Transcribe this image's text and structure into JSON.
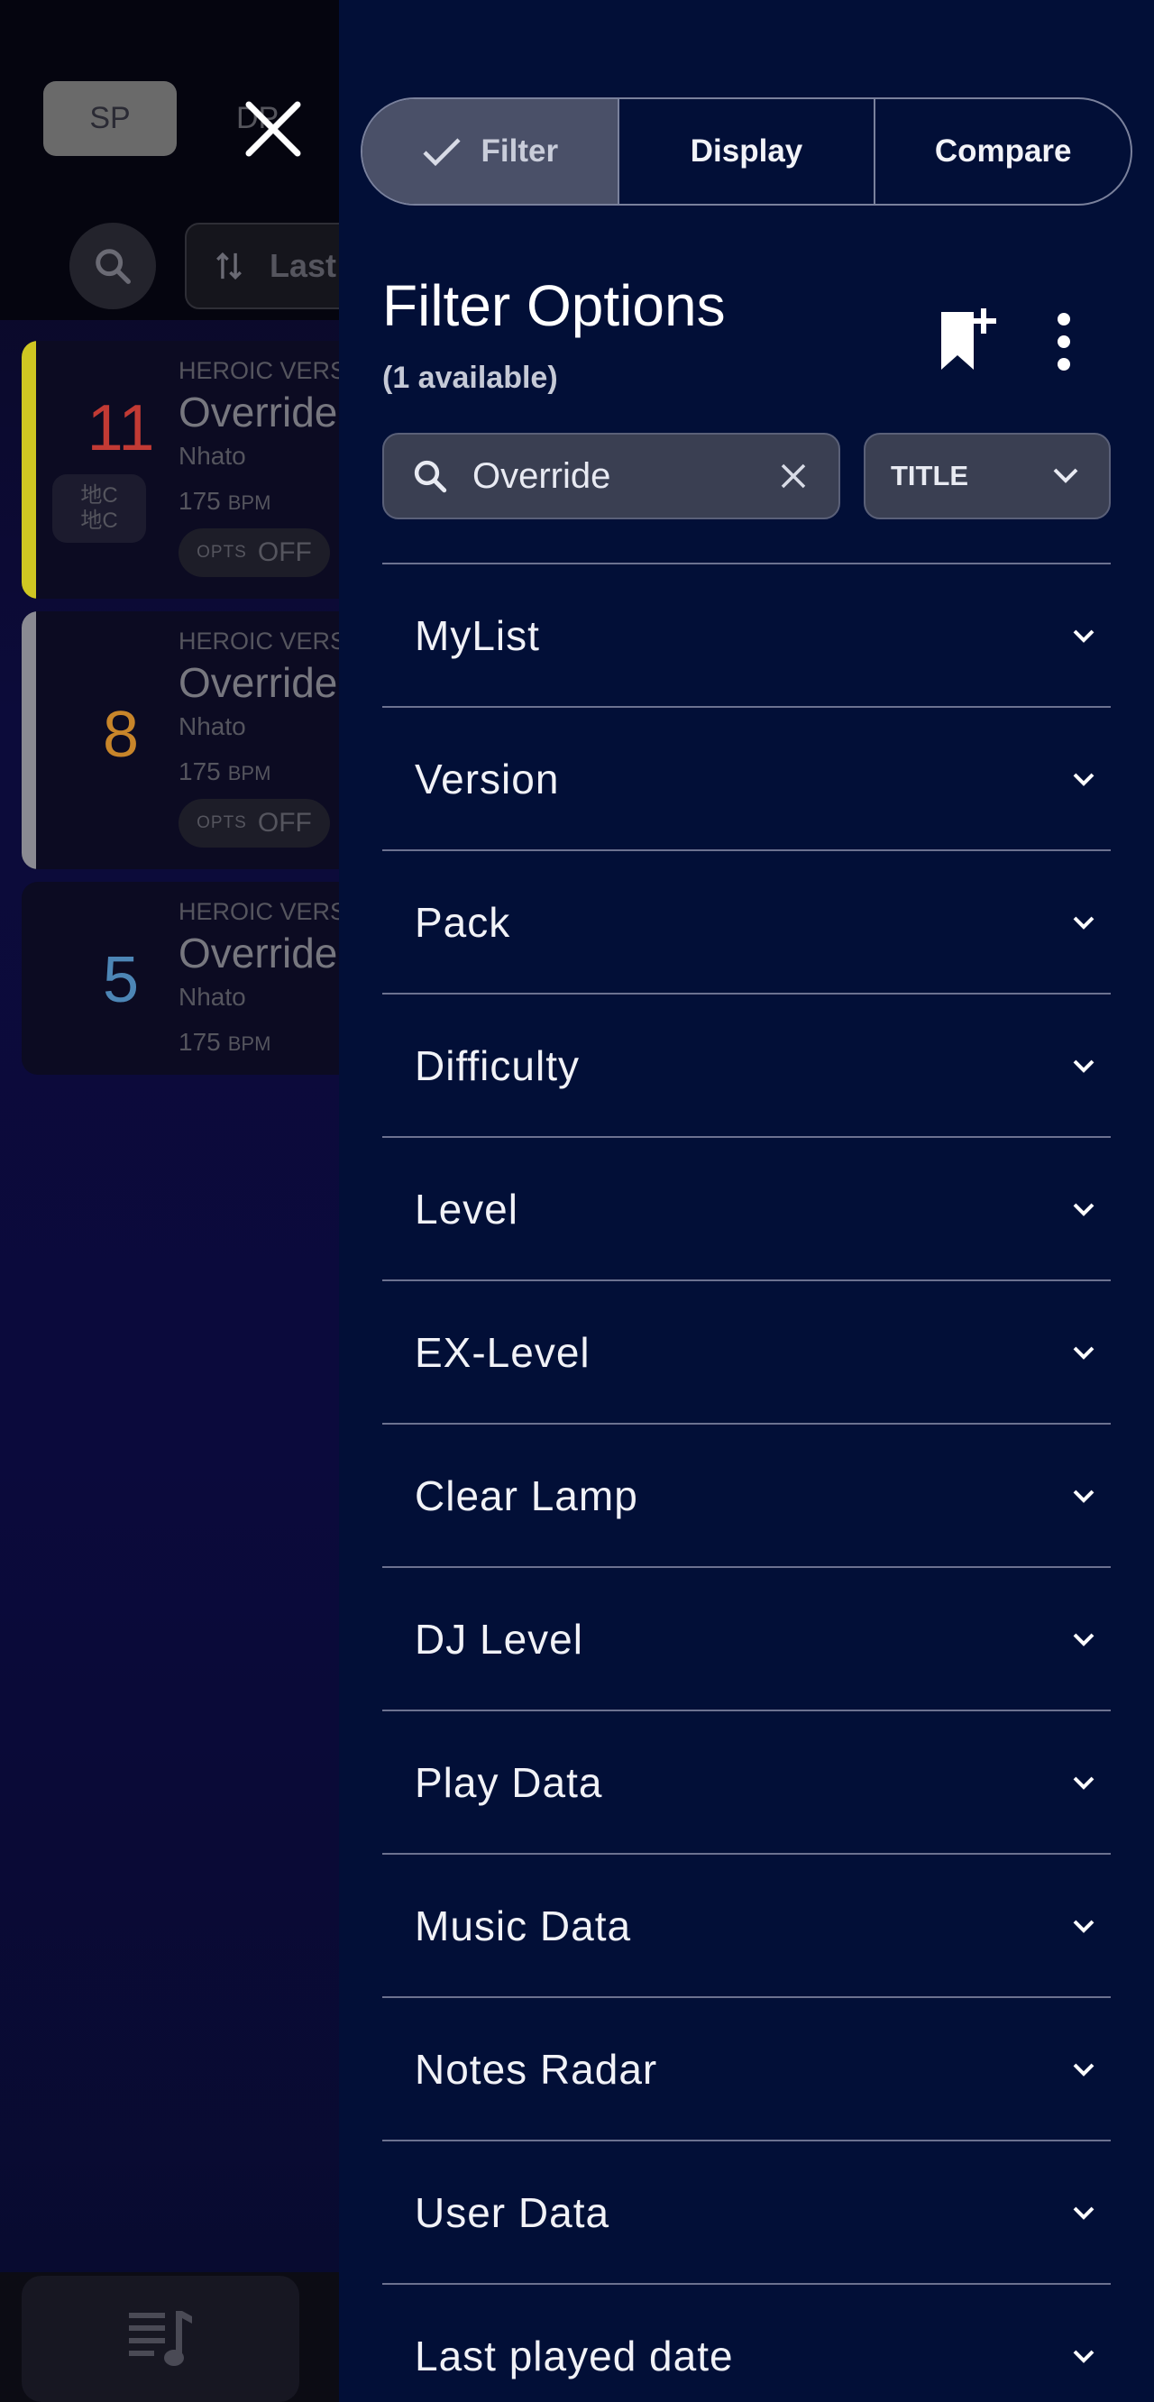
{
  "background": {
    "tabs": {
      "sp": "SP",
      "dp": "DP"
    },
    "sort_label": "Last",
    "songs": [
      {
        "level": "11",
        "version": "HEROIC VERSE",
        "title": "Override",
        "artist": "Nhato",
        "bpm": "175",
        "bpm_unit": "BPM",
        "opts_label": "OPTS",
        "opts_value": "OFF",
        "clear_mark": "地C\n地C",
        "level_color": "#c23a34",
        "stripe_color": "#cfc622"
      },
      {
        "level": "8",
        "version": "HEROIC VERSE",
        "title": "Override",
        "artist": "Nhato",
        "bpm": "175",
        "bpm_unit": "BPM",
        "opts_label": "OPTS",
        "opts_value": "OFF",
        "level_color": "#c8852a",
        "stripe_color": "#8a8a92"
      },
      {
        "level": "5",
        "version": "HEROIC VERSE",
        "title": "Override",
        "artist": "Nhato",
        "bpm": "175",
        "bpm_unit": "BPM",
        "level_color": "#4d86b6",
        "stripe_color": "#0c0b22"
      }
    ]
  },
  "drawer": {
    "tabs": [
      {
        "label": "Filter",
        "active": true
      },
      {
        "label": "Display",
        "active": false
      },
      {
        "label": "Compare",
        "active": false
      }
    ],
    "title": "Filter Options",
    "available": "(1 available)",
    "search": {
      "value": "Override",
      "placeholder": "Search"
    },
    "search_field": "TITLE",
    "sections": [
      "MyList",
      "Version",
      "Pack",
      "Difficulty",
      "Level",
      "EX-Level",
      "Clear Lamp",
      "DJ Level",
      "Play Data",
      "Music Data",
      "Notes Radar",
      "User Data",
      "Last played date"
    ]
  },
  "colors": {
    "drawer_bg": "#020f37",
    "segment_active": "#4a5068",
    "divider": "#6c7290"
  }
}
